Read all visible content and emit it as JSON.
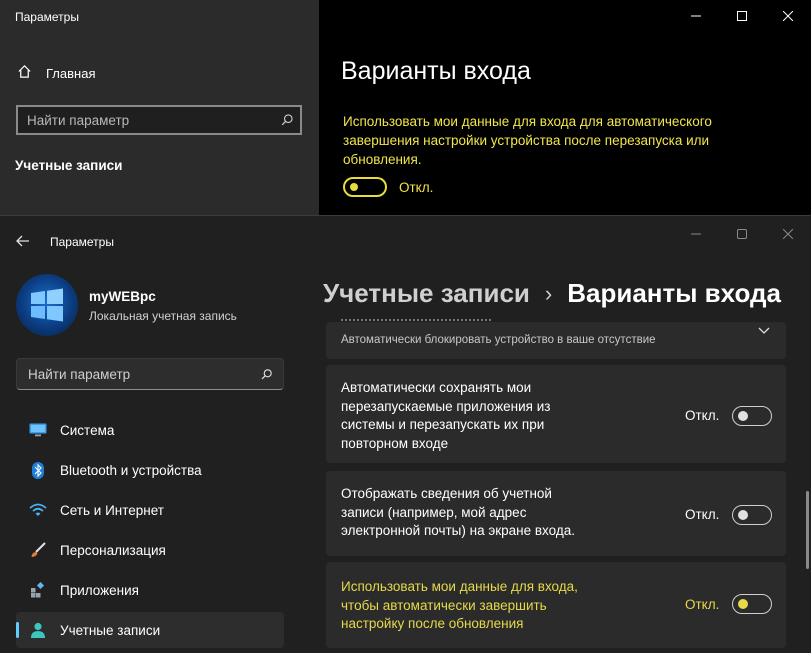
{
  "top_window": {
    "title": "Параметры",
    "home_label": "Главная",
    "search_placeholder": "Найти параметр",
    "section_label": "Учетные записи",
    "heading": "Варианты входа",
    "description": "Использовать мои данные для входа для автоматического завершения настройки устройства после перезапуска или обновления.",
    "toggle_state": "Откл.",
    "accent_color": "#f2e64a"
  },
  "bottom_window": {
    "title": "Параметры",
    "user": {
      "name": "myWEBpc",
      "account_type": "Локальная учетная запись"
    },
    "search_placeholder": "Найти параметр",
    "nav": [
      {
        "label": "Система",
        "icon": "monitor-icon",
        "active": false
      },
      {
        "label": "Bluetooth и устройства",
        "icon": "bluetooth-icon",
        "active": false
      },
      {
        "label": "Сеть и Интернет",
        "icon": "wifi-icon",
        "active": false
      },
      {
        "label": "Персонализация",
        "icon": "brush-icon",
        "active": false
      },
      {
        "label": "Приложения",
        "icon": "apps-icon",
        "active": false
      },
      {
        "label": "Учетные записи",
        "icon": "person-icon",
        "active": true
      }
    ],
    "breadcrumb": {
      "parent": "Учетные записи",
      "separator": "›",
      "current": "Варианты входа"
    },
    "settings": {
      "dynamic_lock_desc": "Автоматически блокировать устройство в ваше отсутствие",
      "items": [
        {
          "text": "Автоматически сохранять мои перезапускаемые приложения из системы и перезапускать их при повторном входе",
          "state": "Откл."
        },
        {
          "text": "Отображать сведения об учетной записи (например, мой адрес электронной почты) на экране входа.",
          "state": "Откл."
        },
        {
          "text": "Использовать мои данные для входа, чтобы автоматически завершить настройку после обновления",
          "state": "Откл.",
          "highlight": true
        }
      ]
    },
    "accent_color": "#60cdff",
    "highlight_color": "#e6d94a"
  }
}
